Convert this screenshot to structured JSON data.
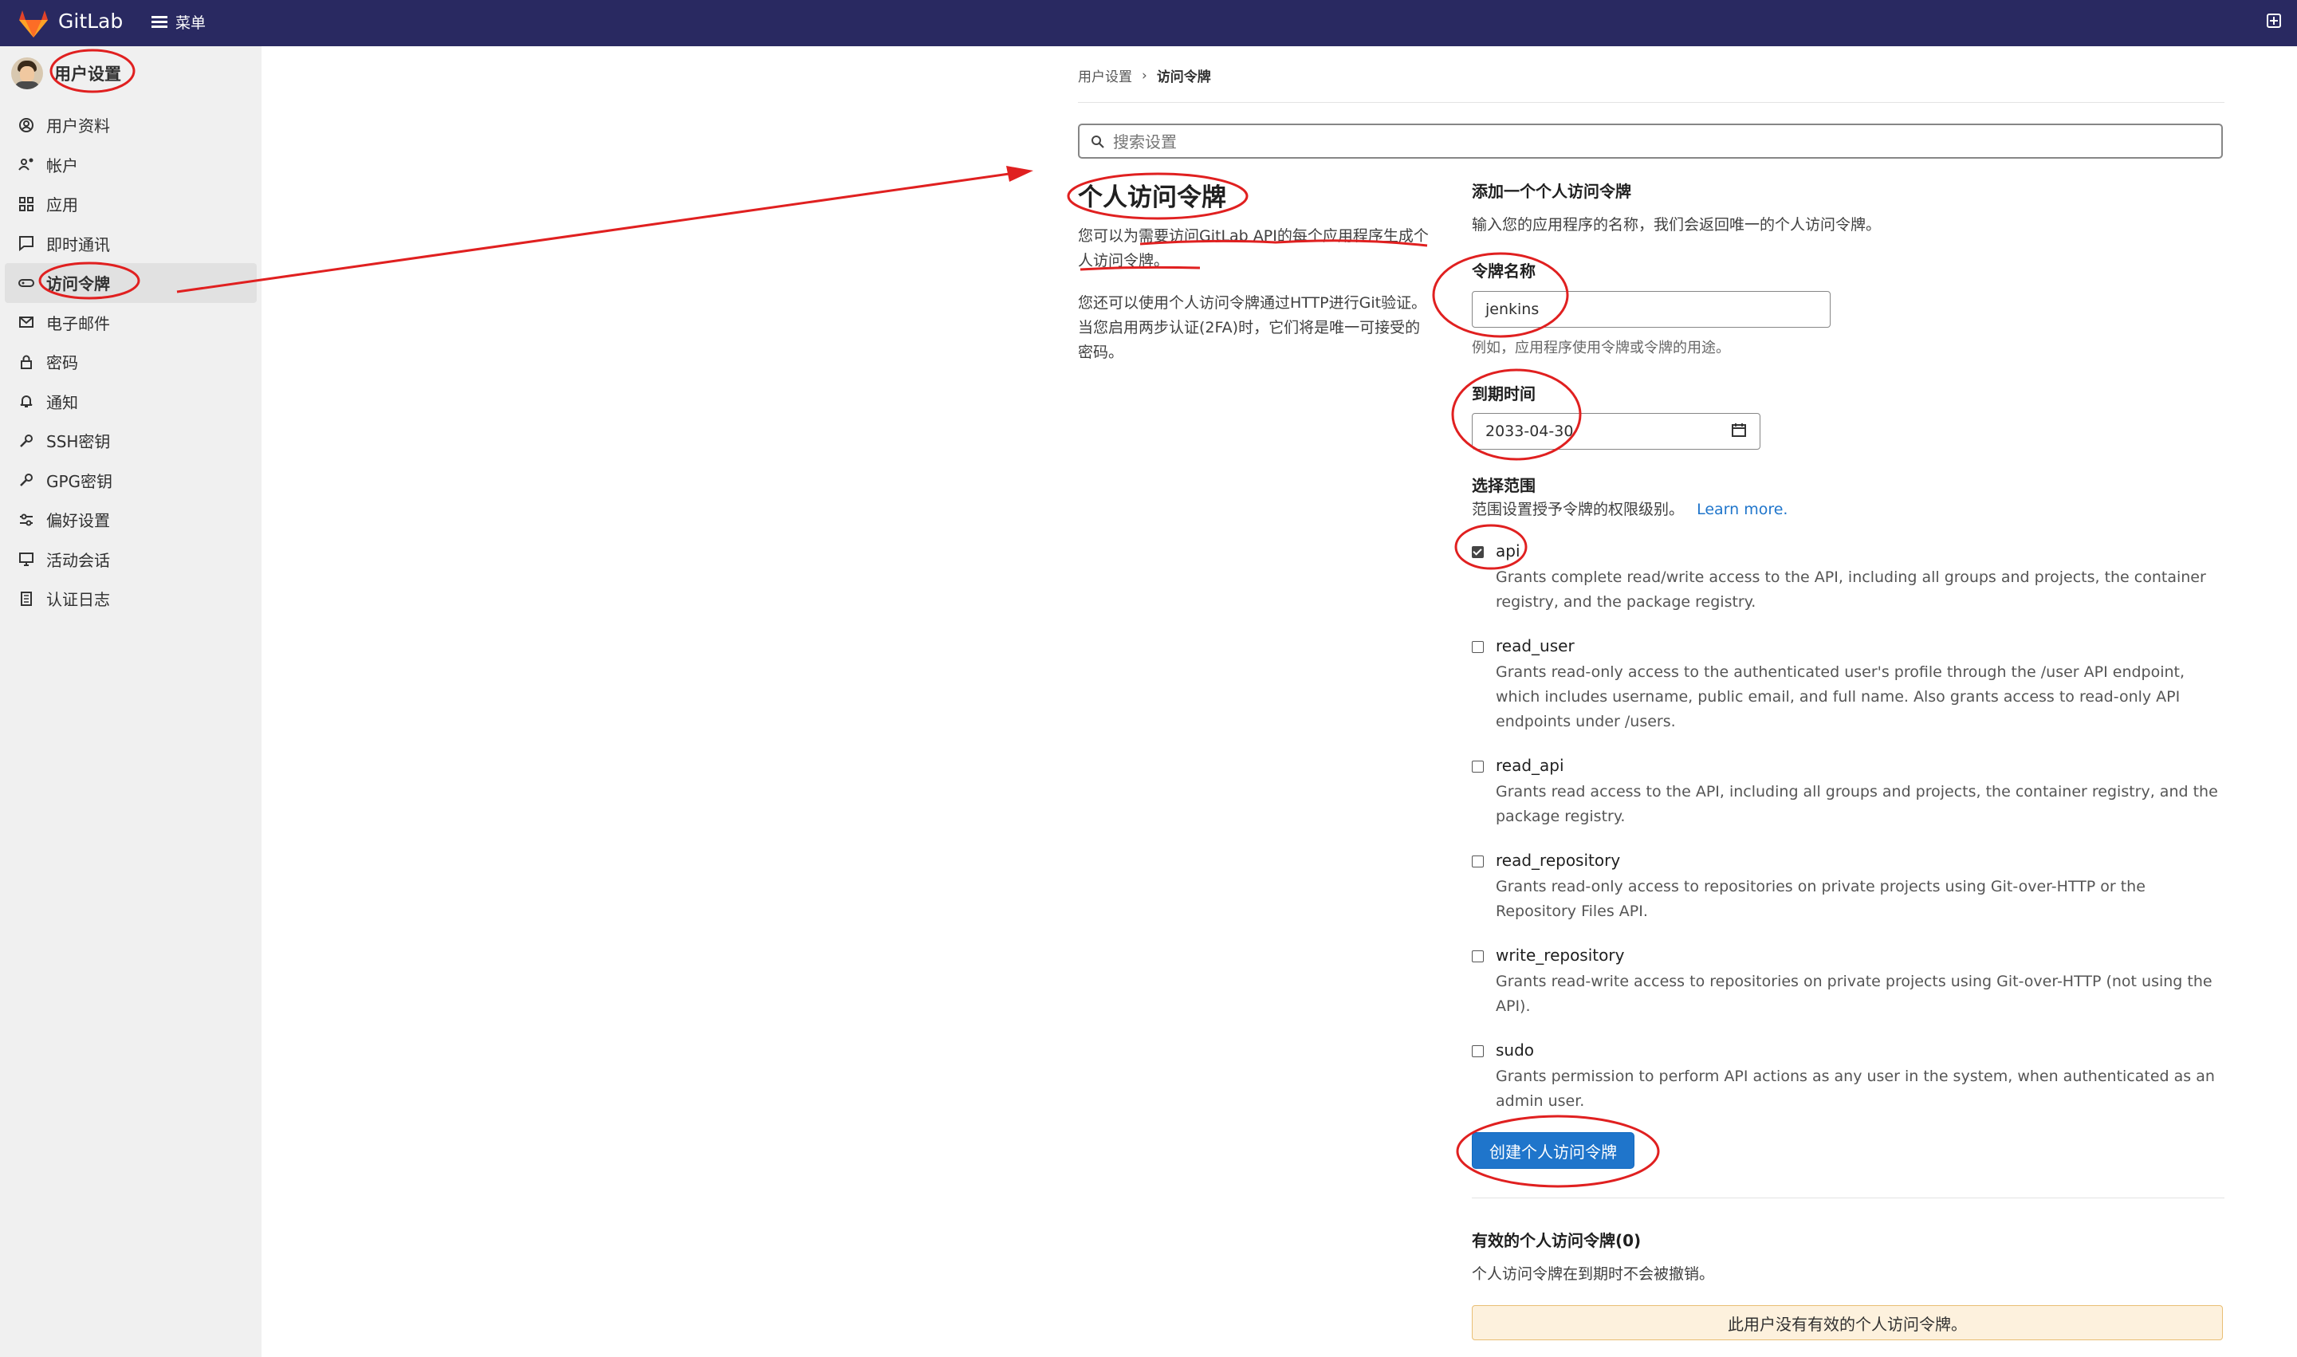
{
  "topbar": {
    "brand": "GitLab",
    "menu_label": "菜单"
  },
  "sidebar": {
    "title": "用户设置",
    "items": [
      {
        "label": "用户资料",
        "icon": "profile-icon"
      },
      {
        "label": "帐户",
        "icon": "account-icon"
      },
      {
        "label": "应用",
        "icon": "applications-icon"
      },
      {
        "label": "即时通讯",
        "icon": "chat-icon"
      },
      {
        "label": "访问令牌",
        "icon": "token-icon",
        "active": true
      },
      {
        "label": "电子邮件",
        "icon": "email-icon"
      },
      {
        "label": "密码",
        "icon": "lock-icon"
      },
      {
        "label": "通知",
        "icon": "bell-icon"
      },
      {
        "label": "SSH密钥",
        "icon": "key-icon"
      },
      {
        "label": "GPG密钥",
        "icon": "key-icon"
      },
      {
        "label": "偏好设置",
        "icon": "preferences-icon"
      },
      {
        "label": "活动会话",
        "icon": "monitor-icon"
      },
      {
        "label": "认证日志",
        "icon": "log-icon"
      }
    ]
  },
  "breadcrumb": {
    "parent": "用户设置",
    "current": "访问令牌"
  },
  "search": {
    "placeholder": "搜索设置"
  },
  "intro": {
    "title": "个人访问令牌",
    "desc1": "您可以为需要访问GitLab API的每个应用程序生成个人访问令牌。",
    "desc2": "您还可以使用个人访问令牌通过HTTP进行Git验证。 当您启用两步认证(2FA)时，它们将是唯一可接受的密码。"
  },
  "form": {
    "section_title": "添加一个个人访问令牌",
    "section_desc": "输入您的应用程序的名称，我们会返回唯一的个人访问令牌。",
    "name_label": "令牌名称",
    "name_value": "jenkins",
    "name_hint": "例如，应用程序使用令牌或令牌的用途。",
    "expiry_label": "到期时间",
    "expiry_value": "2033-04-30",
    "scopes_label": "选择范围",
    "scopes_desc": "范围设置授予令牌的权限级别。",
    "learn_more": "Learn more.",
    "scopes": [
      {
        "name": "api",
        "checked": true,
        "desc": "Grants complete read/write access to the API, including all groups and projects, the container registry, and the package registry."
      },
      {
        "name": "read_user",
        "checked": false,
        "desc": "Grants read-only access to the authenticated user's profile through the /user API endpoint, which includes username, public email, and full name. Also grants access to read-only API endpoints under /users."
      },
      {
        "name": "read_api",
        "checked": false,
        "desc": "Grants read access to the API, including all groups and projects, the container registry, and the package registry."
      },
      {
        "name": "read_repository",
        "checked": false,
        "desc": "Grants read-only access to repositories on private projects using Git-over-HTTP or the Repository Files API."
      },
      {
        "name": "write_repository",
        "checked": false,
        "desc": "Grants read-write access to repositories on private projects using Git-over-HTTP (not using the API)."
      },
      {
        "name": "sudo",
        "checked": false,
        "desc": "Grants permission to perform API actions as any user in the system, when authenticated as an admin user."
      }
    ],
    "create_button": "创建个人访问令牌"
  },
  "active_tokens": {
    "title": "有效的个人访问令牌(0)",
    "desc": "个人访问令牌在到期时不会被撤销。",
    "empty": "此用户没有有效的个人访问令牌。"
  },
  "colors": {
    "topbar": "#292961",
    "primary": "#1f75cb",
    "annotation": "#e02020",
    "warning_bg": "#fdf1dd"
  }
}
